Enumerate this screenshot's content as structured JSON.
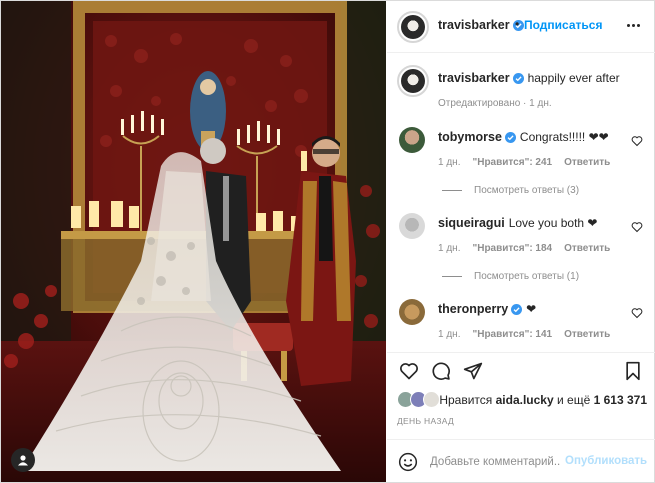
{
  "header": {
    "username": "travisbarker",
    "separator": "•",
    "follow_label": "Подписаться"
  },
  "caption": {
    "username": "travisbarker",
    "text": "happily ever after",
    "edited": "Отредактировано",
    "time": "1 дн."
  },
  "comments": [
    {
      "username": "tobymorse",
      "verified": true,
      "text": "Congrats!!!!! ❤❤",
      "time": "1 дн.",
      "likes": "\"Нравится\": 241",
      "reply_label": "Ответить",
      "view_replies": "Посмотреть ответы (3)"
    },
    {
      "username": "siqueiragui",
      "verified": false,
      "text": "Love you both ❤",
      "time": "1 дн.",
      "likes": "\"Нравится\": 184",
      "reply_label": "Ответить",
      "view_replies": "Посмотреть ответы (1)"
    },
    {
      "username": "theronperry",
      "verified": true,
      "text": "❤",
      "time": "1 дн.",
      "likes": "\"Нравится\": 141",
      "reply_label": "Ответить"
    }
  ],
  "actions": {
    "icons": [
      "heart-icon",
      "comment-icon",
      "share-icon",
      "bookmark-icon"
    ]
  },
  "likes": {
    "prefix": "Нравится",
    "user": "aida.lucky",
    "middle": "и ещё",
    "count": "1 613 371"
  },
  "date_label": "ДЕНЬ НАЗАД",
  "add_comment": {
    "placeholder": "Добавьте комментарий...",
    "post_label": "Опубликовать"
  },
  "colors": {
    "accent": "#0095f6",
    "verified": "#3897f0",
    "disabled_post": "#b2dffc",
    "muted_text": "#8e8e8e"
  }
}
